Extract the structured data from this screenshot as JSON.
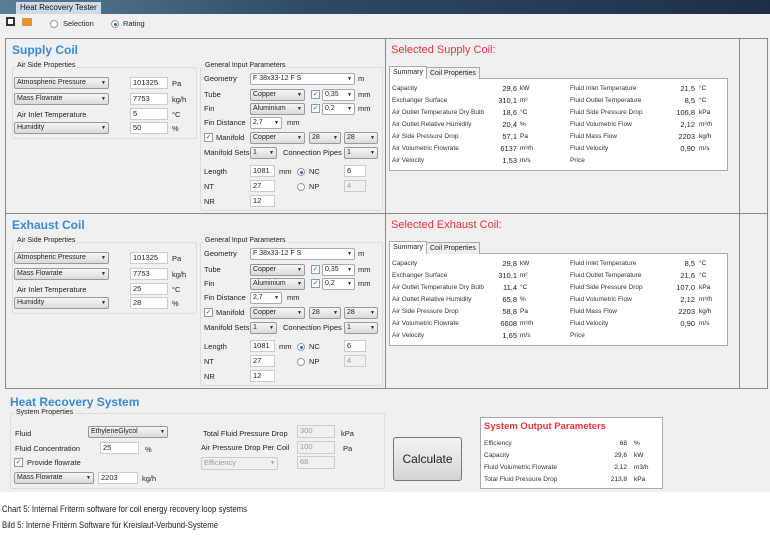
{
  "window": {
    "title": "Heat Recovery Tester"
  },
  "toolbar": {
    "save_icon": "save-icon",
    "open_icon": "folder-icon",
    "mode_options": [
      "Selection",
      "Rating"
    ],
    "selected_mode": "Rating"
  },
  "coils": [
    {
      "key": "supply",
      "title": "Supply Coil",
      "air_side": {
        "group_label": "Air Side Properties",
        "rows": [
          {
            "label": "Atmospheric Pressure",
            "type": "dropdown",
            "value": "101325",
            "unit": "Pa"
          },
          {
            "label": "Mass Flowrate",
            "type": "dropdown",
            "value": "7753",
            "unit": "kg/h"
          },
          {
            "label": "Air Inlet Temperature",
            "type": "label",
            "value": "5",
            "unit": "°C"
          },
          {
            "label": "Humidity",
            "type": "dropdown",
            "value": "50",
            "unit": "%"
          }
        ]
      },
      "general": {
        "group_label": "General Input Parameters",
        "geometry_label": "Geometry",
        "geometry": "F 38x33-12 F S",
        "geometry_unit": "m",
        "tube_label": "Tube",
        "tube": "Copper",
        "tube_checked": true,
        "tube_thickness": "0,35",
        "tube_unit": "mm",
        "fin_label": "Fin",
        "fin": "Aluminium",
        "fin_checked": true,
        "fin_thickness": "0,2",
        "fin_unit": "mm",
        "fin_distance_label": "Fin Distance",
        "fin_distance": "2,7",
        "fin_distance_unit": "mm",
        "manifold_label": "Manifold",
        "manifold_checked": true,
        "manifold_material": "Copper",
        "manifold_size1": "28",
        "manifold_size2": "28",
        "manifold_sets_label": "Manifold Sets",
        "manifold_sets": "1",
        "connection_pipes_label": "Connection Pipes",
        "connection_pipes": "1",
        "length_label": "Length",
        "length": "1081",
        "length_unit": "mm",
        "nt_label": "NT",
        "nt": "27",
        "nr_label": "NR",
        "nr": "12",
        "nc_label": "NC",
        "nc": "6",
        "np_label": "NP",
        "np": "4",
        "selected_radio": "NC"
      },
      "result": {
        "title": "Selected Supply Coil:",
        "tabs": [
          "Summary",
          "Coil Properties"
        ],
        "active_tab": "Summary",
        "left": [
          [
            "Capacity",
            "29,6",
            "kW"
          ],
          [
            "Exchanger Surface",
            "310,1",
            "m²"
          ],
          [
            "Air Outlet Temperature Dry Bulb",
            "18,6",
            "°C"
          ],
          [
            "Air Outlet Relative Humidity",
            "20,4",
            "%"
          ],
          [
            "Air Side Pressure Drop",
            "57,1",
            "Pa"
          ],
          [
            "Air Volumetric Flowrate",
            "6137",
            "m³/h"
          ],
          [
            "Air Velocity",
            "1,53",
            "m/s"
          ]
        ],
        "right": [
          [
            "Fluid Inlet Temperature",
            "21,5",
            "°C"
          ],
          [
            "Fluid Outlet Temperature",
            "8,5",
            "°C"
          ],
          [
            "Fluid Side Pressure Drop",
            "106,8",
            "kPa"
          ],
          [
            "Fluid Volumetric Flow",
            "2,12",
            "m³/h"
          ],
          [
            "Fluid Mass Flow",
            "2203",
            "kg/h"
          ],
          [
            "Fluid Velocity",
            "0,90",
            "m/s"
          ],
          [
            "Price",
            "",
            ""
          ]
        ]
      }
    },
    {
      "key": "exhaust",
      "title": "Exhaust Coil",
      "air_side": {
        "group_label": "Air Side Properties",
        "rows": [
          {
            "label": "Atmospheric Pressure",
            "type": "dropdown",
            "value": "101325",
            "unit": "Pa"
          },
          {
            "label": "Mass Flowrate",
            "type": "dropdown",
            "value": "7753",
            "unit": "kg/h"
          },
          {
            "label": "Air Inlet Temperature",
            "type": "label",
            "value": "25",
            "unit": "°C"
          },
          {
            "label": "Humidity",
            "type": "dropdown",
            "value": "28",
            "unit": "%"
          }
        ]
      },
      "general": {
        "group_label": "General Input Parameters",
        "geometry_label": "Geometry",
        "geometry": "F 38x33-12 F S",
        "geometry_unit": "m",
        "tube_label": "Tube",
        "tube": "Copper",
        "tube_checked": true,
        "tube_thickness": "0,35",
        "tube_unit": "mm",
        "fin_label": "Fin",
        "fin": "Aluminium",
        "fin_checked": true,
        "fin_thickness": "0,2",
        "fin_unit": "mm",
        "fin_distance_label": "Fin Distance",
        "fin_distance": "2,7",
        "fin_distance_unit": "mm",
        "manifold_label": "Manifold",
        "manifold_checked": true,
        "manifold_material": "Copper",
        "manifold_size1": "28",
        "manifold_size2": "28",
        "manifold_sets_label": "Manifold Sets",
        "manifold_sets": "1",
        "connection_pipes_label": "Connection Pipes",
        "connection_pipes": "1",
        "length_label": "Length",
        "length": "1081",
        "length_unit": "mm",
        "nt_label": "NT",
        "nt": "27",
        "nr_label": "NR",
        "nr": "12",
        "nc_label": "NC",
        "nc": "6",
        "np_label": "NP",
        "np": "4",
        "selected_radio": "NC"
      },
      "result": {
        "title": "Selected Exhaust Coil:",
        "tabs": [
          "Summary",
          "Coil Properties"
        ],
        "active_tab": "Summary",
        "left": [
          [
            "Capacity",
            "29,8",
            "kW"
          ],
          [
            "Exchanger Surface",
            "310,1",
            "m²"
          ],
          [
            "Air Outlet Temperature Dry Bulb",
            "11,4",
            "°C"
          ],
          [
            "Air Outlet Relative Humidity",
            "65,8",
            "%"
          ],
          [
            "Air Side Pressure Drop",
            "58,8",
            "Pa"
          ],
          [
            "Air Volumetric Flowrate",
            "6608",
            "m³/h"
          ],
          [
            "Air Velocity",
            "1,65",
            "m/s"
          ]
        ],
        "right": [
          [
            "Fluid Inlet Temperature",
            "8,5",
            "°C"
          ],
          [
            "Fluid Outlet Temperature",
            "21,6",
            "°C"
          ],
          [
            "Fluid Side Pressure Drop",
            "107,0",
            "kPa"
          ],
          [
            "Fluid Volumetric Flow",
            "2,12",
            "m³/h"
          ],
          [
            "Fluid Mass Flow",
            "2203",
            "kg/h"
          ],
          [
            "Fluid Velocity",
            "0,90",
            "m/s"
          ],
          [
            "Price",
            "",
            ""
          ]
        ]
      }
    }
  ],
  "system": {
    "title": "Heat Recovery System",
    "group_label": "System Properties",
    "fluid_label": "Fluid",
    "fluid": "EthyleneGlycol",
    "concentration_label": "Fluid Concentration",
    "concentration": "25",
    "concentration_unit": "%",
    "provide_flowrate_label": "Provide flowrate",
    "provide_flowrate_checked": true,
    "flow_type": "Mass Flowrate",
    "flow_value": "2203",
    "flow_unit": "kg/h",
    "total_drop_label": "Total Fluid Pressure Drop",
    "total_drop": "300",
    "total_drop_unit": "kPa",
    "air_drop_label": "Air Pressure Drop Per Coil",
    "air_drop": "100",
    "air_drop_unit": "Pa",
    "target_type": "Efficiency",
    "target_value": "68",
    "calculate_label": "Calculate",
    "output": {
      "title": "System Output Parameters",
      "rows": [
        [
          "Efficiency",
          "68",
          "%"
        ],
        [
          "Capacity",
          "29,6",
          "kW"
        ],
        [
          "Fluid Volumetric Flowrate",
          "2,12",
          "m3/h"
        ],
        [
          "Total Fluid Pressure Drop",
          "213,8",
          "kPa"
        ]
      ]
    }
  },
  "captions": [
    "Chart 5: Internal Friterm software for coil energy recovery loop systems",
    "Bild 5: Interne Friterm Software für Kreislauf-Verbund-Systeme"
  ],
  "colors": {
    "section_title": "#3a8ad6",
    "result_title": "#e8333c"
  }
}
